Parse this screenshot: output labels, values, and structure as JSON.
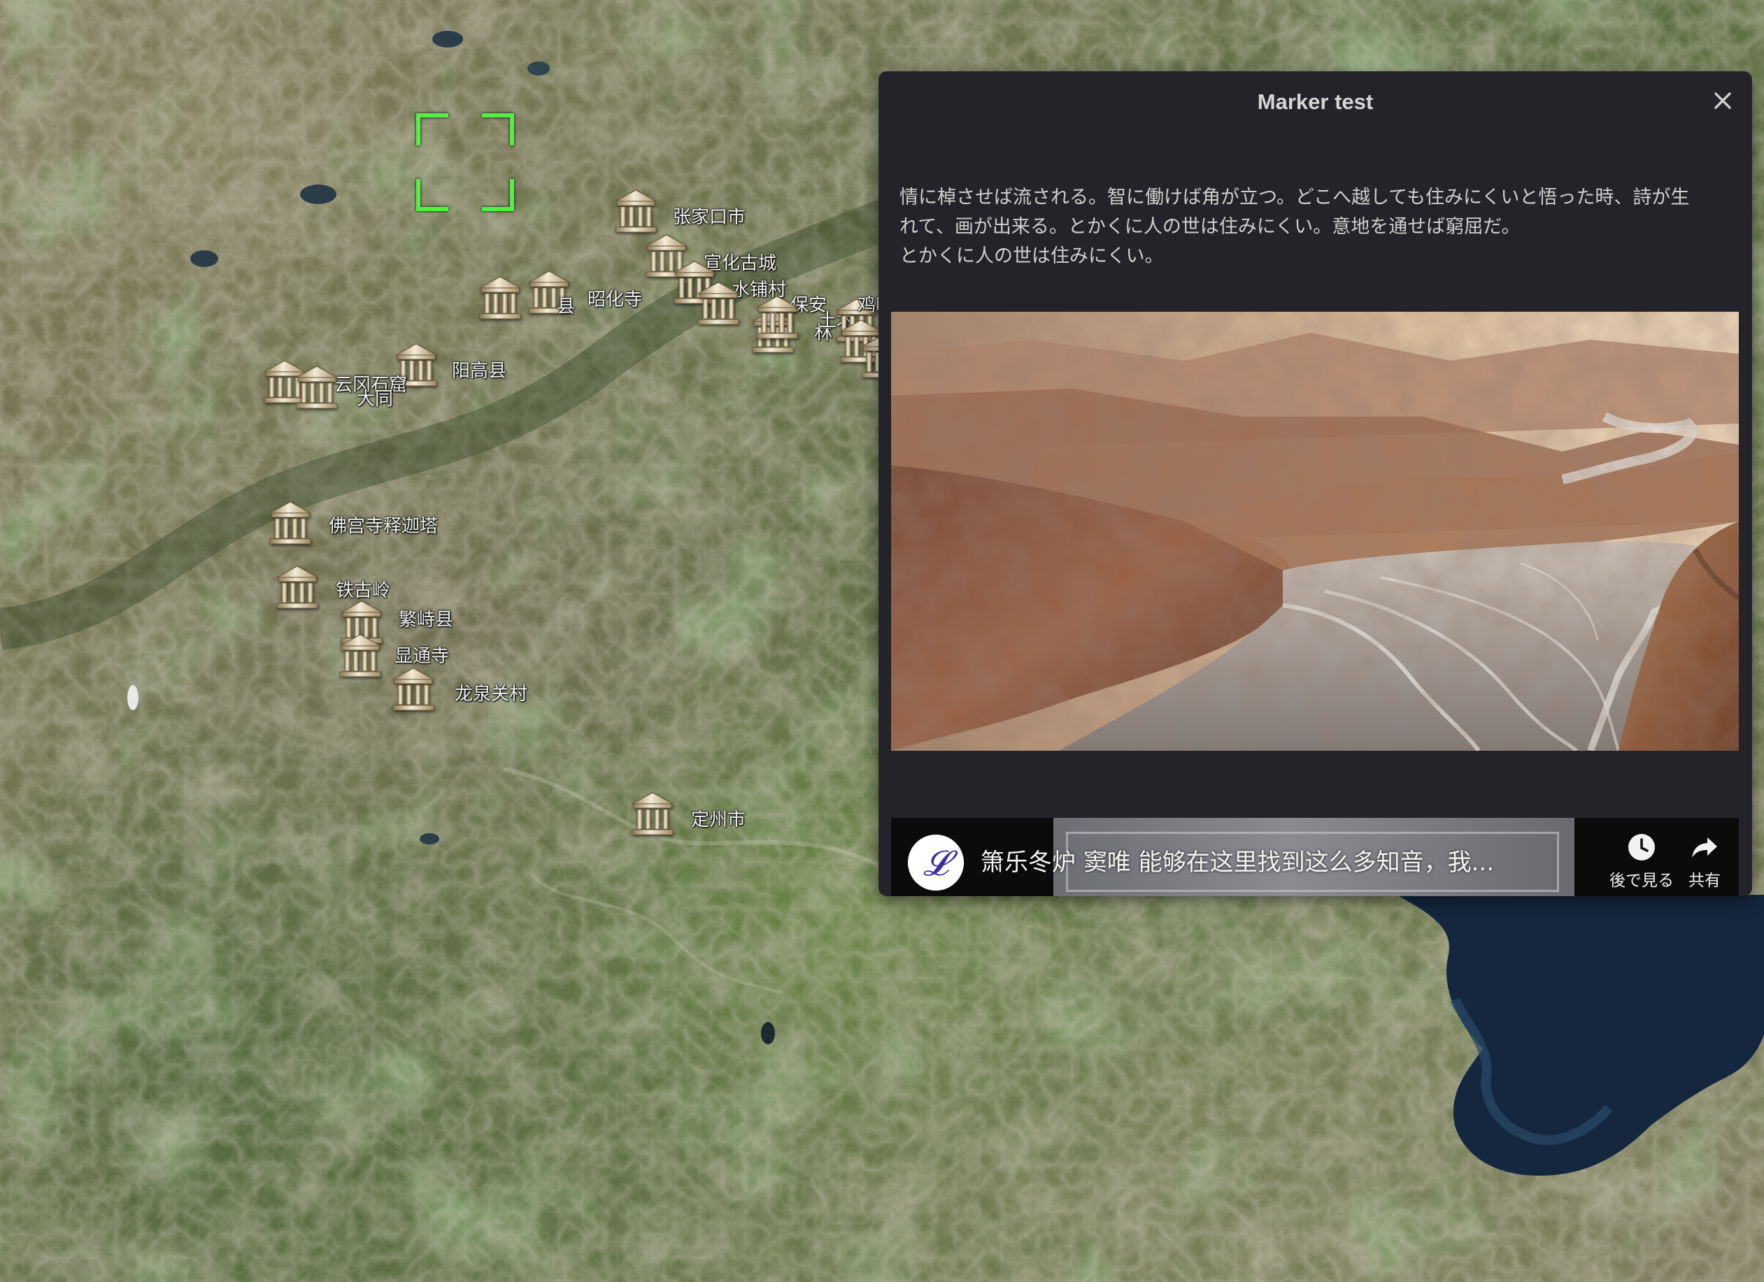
{
  "map": {
    "markers": [
      {
        "name": "marker-zhangjiakou",
        "label": "张家口市"
      },
      {
        "name": "marker-xuanhua",
        "label": "宣化古城"
      },
      {
        "name": "marker-shuipu",
        "label": "水铺村"
      },
      {
        "name": "marker-zhaohuasi",
        "label": "昭化寺"
      },
      {
        "name": "marker-zhen",
        "label": "县"
      },
      {
        "name": "marker-yanggao",
        "label": "阳高县"
      },
      {
        "name": "marker-yungang",
        "label": "云冈石窟"
      },
      {
        "name": "marker-datong",
        "label": "大同"
      },
      {
        "name": "marker-fogong",
        "label": "佛宫寺释迦塔"
      },
      {
        "name": "marker-tieshaling",
        "label": "铁古岭"
      },
      {
        "name": "marker-fanshi",
        "label": "繁峙县"
      },
      {
        "name": "marker-xiantong",
        "label": "显通寺"
      },
      {
        "name": "marker-longquanguan",
        "label": "龙泉关村"
      },
      {
        "name": "marker-dingzhou",
        "label": "定州市"
      },
      {
        "name": "marker-east1",
        "label": "保安"
      },
      {
        "name": "marker-east2",
        "label": "林"
      },
      {
        "name": "marker-east3",
        "label": "土木"
      },
      {
        "name": "marker-east4",
        "label": "鸡鸣"
      },
      {
        "name": "marker-east5",
        "label": ""
      },
      {
        "name": "marker-east6",
        "label": ""
      }
    ]
  },
  "panel": {
    "title": "Marker test",
    "close_icon": "close-icon",
    "body_lines": [
      "情に棹させば流される。智に働けば角が立つ。どこへ越しても住みにくいと悟った時、詩が生",
      "れて、画が出来る。とかくに人の世は住みにくい。意地を通せば窮屈だ。",
      "とかくに人の世は住みにくい。"
    ]
  },
  "video": {
    "title": "箫乐冬炉 窦唯 能够在这里找到这么多知音，我...",
    "avatar_glyph": "𝓛",
    "watch_later_label": "後で見る",
    "share_label": "共有",
    "watch_later_icon": "clock-icon",
    "share_icon": "share-icon"
  },
  "colors": {
    "panel_bg": "#232329",
    "focus_bracket": "#55ee44",
    "avatar_ink": "#3a2f9a"
  }
}
